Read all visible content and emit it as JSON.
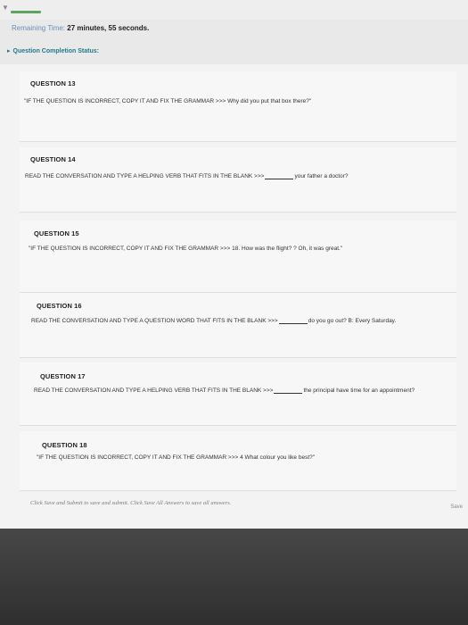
{
  "timer": {
    "label": "Remaining Time:",
    "value": "27 minutes, 55 seconds."
  },
  "status": {
    "label": "Question Completion Status:"
  },
  "questions": [
    {
      "title": "QUESTION 13",
      "prefix": "\"IF THE QUESTION IS INCORRECT, COPY IT AND FIX THE GRAMMAR >>> Why did you put that box there?\"",
      "suffix": ""
    },
    {
      "title": "QUESTION 14",
      "prefix": "READ THE CONVERSATION AND TYPE A HELPING VERB THAT FITS IN THE BLANK >>>",
      "suffix": "your father a doctor?"
    },
    {
      "title": "QUESTION 15",
      "prefix": "\"IF THE QUESTION IS INCORRECT, COPY IT AND FIX THE GRAMMAR >>> 18. How was the flight? ? Oh, it was great.\"",
      "suffix": ""
    },
    {
      "title": "QUESTION 16",
      "prefix": "READ THE CONVERSATION AND TYPE A QUESTION WORD THAT FITS IN THE BLANK >>>",
      "suffix": "do you go out? B: Every Saturday."
    },
    {
      "title": "QUESTION 17",
      "prefix": "READ THE CONVERSATION AND TYPE A HELPING VERB THAT FITS IN THE BLANK >>>",
      "suffix": "the principal have time for an appointment?"
    },
    {
      "title": "QUESTION 18",
      "prefix": "\"IF THE QUESTION IS INCORRECT, COPY IT AND FIX THE GRAMMAR >>> 4 What colour you like best?\"",
      "suffix": ""
    }
  ],
  "footer": {
    "note": "Click Save and Submit to save and submit. Click Save All Answers to save all answers.",
    "save_label": "Save"
  },
  "colors": {
    "accent": "#1e7a8c",
    "progress": "#5fa35f",
    "dark": "#3b3b3b"
  }
}
